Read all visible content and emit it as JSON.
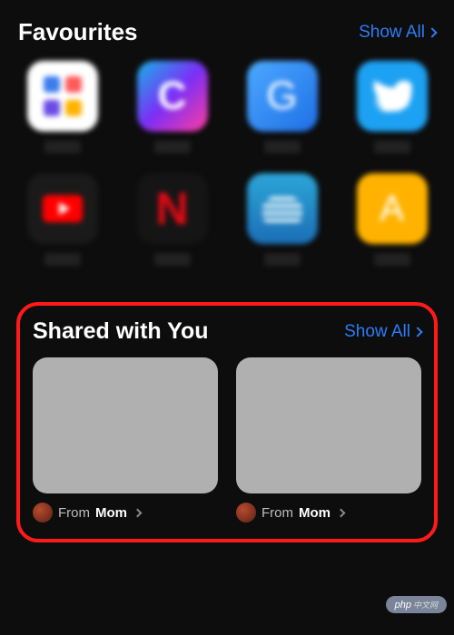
{
  "favourites": {
    "title": "Favourites",
    "show_all_label": "Show All",
    "items": [
      {
        "name": "Apps"
      },
      {
        "name": "Canva"
      },
      {
        "name": "Google"
      },
      {
        "name": "Twitter"
      },
      {
        "name": "YouTube"
      },
      {
        "name": "Netflix"
      },
      {
        "name": "Prime"
      },
      {
        "name": "Amazon"
      }
    ]
  },
  "shared": {
    "title": "Shared with You",
    "show_all_label": "Show All",
    "cards": [
      {
        "from_prefix": "From ",
        "from_name": "Mom"
      },
      {
        "from_prefix": "From ",
        "from_name": "Mom"
      }
    ]
  },
  "watermark": {
    "text": "php",
    "sub": "中文网"
  },
  "colors": {
    "accent": "#2e7cf6",
    "highlight_border": "#ff1a1a"
  }
}
